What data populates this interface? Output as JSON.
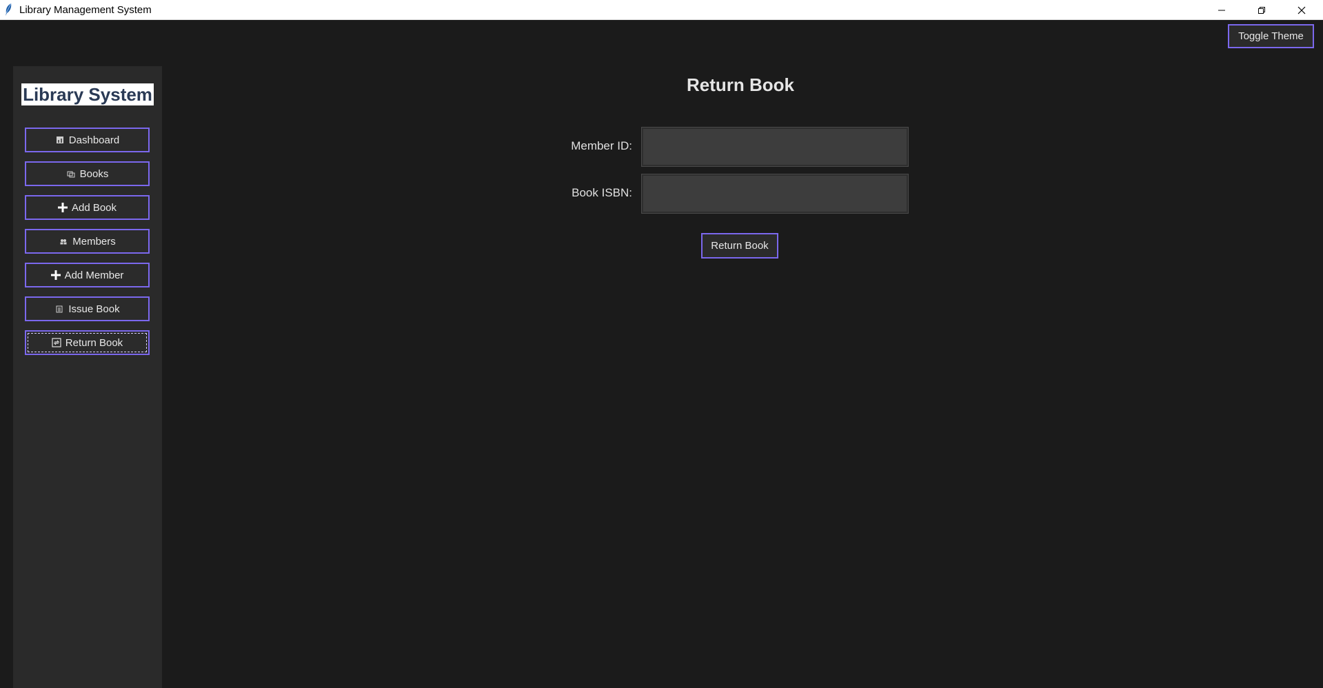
{
  "window": {
    "title": "Library Management System"
  },
  "header": {
    "toggle_theme_label": "Toggle Theme"
  },
  "sidebar": {
    "brand": "Library System",
    "items": [
      {
        "label": "Dashboard",
        "icon": "dashboard-icon"
      },
      {
        "label": "Books",
        "icon": "books-icon"
      },
      {
        "label": "Add Book",
        "icon": "plus-icon"
      },
      {
        "label": "Members",
        "icon": "members-icon"
      },
      {
        "label": "Add Member",
        "icon": "plus-icon"
      },
      {
        "label": "Issue Book",
        "icon": "clipboard-icon"
      },
      {
        "label": "Return Book",
        "icon": "return-icon",
        "active": true
      }
    ]
  },
  "main": {
    "title": "Return Book",
    "fields": [
      {
        "label": "Member ID:",
        "value": "",
        "placeholder": ""
      },
      {
        "label": "Book ISBN:",
        "value": "",
        "placeholder": ""
      }
    ],
    "submit_label": "Return Book"
  },
  "colors": {
    "background": "#1b1b1b",
    "sidebar": "#2a2a2a",
    "accent": "#7b68ee",
    "input_bg": "#3d3d3d",
    "brand_text": "#2a3a55"
  }
}
